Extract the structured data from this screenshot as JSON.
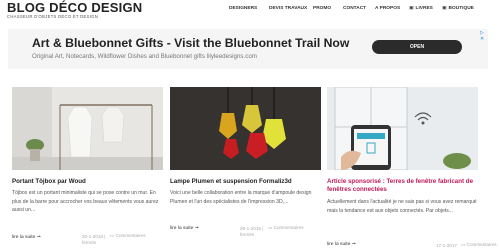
{
  "header": {
    "logo": "BLOG DÉCO DESIGN",
    "tagline": "CHASSEUR D'OBJETS DÉCO ET DESIGN",
    "nav": [
      {
        "label": "DESIGNERS"
      },
      {
        "label": "DEVIS TRAVAUX"
      },
      {
        "label": "PROMO"
      },
      {
        "label": "CONTACT"
      },
      {
        "label": "A PROPOS"
      },
      {
        "label": "LIVRES",
        "icon": "book-icon"
      },
      {
        "label": "BOUTIQUE",
        "icon": "shop-icon"
      }
    ]
  },
  "ad": {
    "title": "Art & Bluebonnet Gifts - Visit the Bluebonnet Trail Now",
    "subtitle": "Original Art, Notecards, Wildflower Dishes and Bluebonnet gifts lilyleedesigns.com",
    "button": "OPEN"
  },
  "articles": [
    {
      "title": "Portant Töjbox par Woud",
      "excerpt": "Töjbox est un portant minimaliste qui se pose contre un mur. En plus de la barre pour accrocher vos beaux vêtements vous aurez aussi un...",
      "read_more": "lire la suite ➞",
      "date": "20-1-2018",
      "date_suffix": "|",
      "comments_word": "Commentaires",
      "comments_line2": "fermés"
    },
    {
      "title": "Lampe Plumen et suspension Formaliz3d",
      "excerpt": "Voici une belle collaboration entre la marque d'ampoule design Plumen et l'un des spécialistes de l'impression 3D,...",
      "read_more": "lire la suite ➞",
      "date": "29-1-2018",
      "date_suffix": "|",
      "comments_word": "Commentaires",
      "comments_line2": "fermés"
    },
    {
      "title": "Article sponsorisé : Terres de fenêtre fabricant de fenêtres connectées",
      "excerpt": "Actuellement dans l'actualité je ne sais pas si vous avez remarqué mais la tendance est aux objets connectés. Par objets...",
      "read_more": "lire la suite ➞",
      "date": "17-1-2017",
      "comments_word": "Commentaires"
    }
  ],
  "colors": {
    "ad_button": "#2b2b2b",
    "sponsored_title": "#c2185b",
    "ad_badge": "#1a8ad0"
  }
}
